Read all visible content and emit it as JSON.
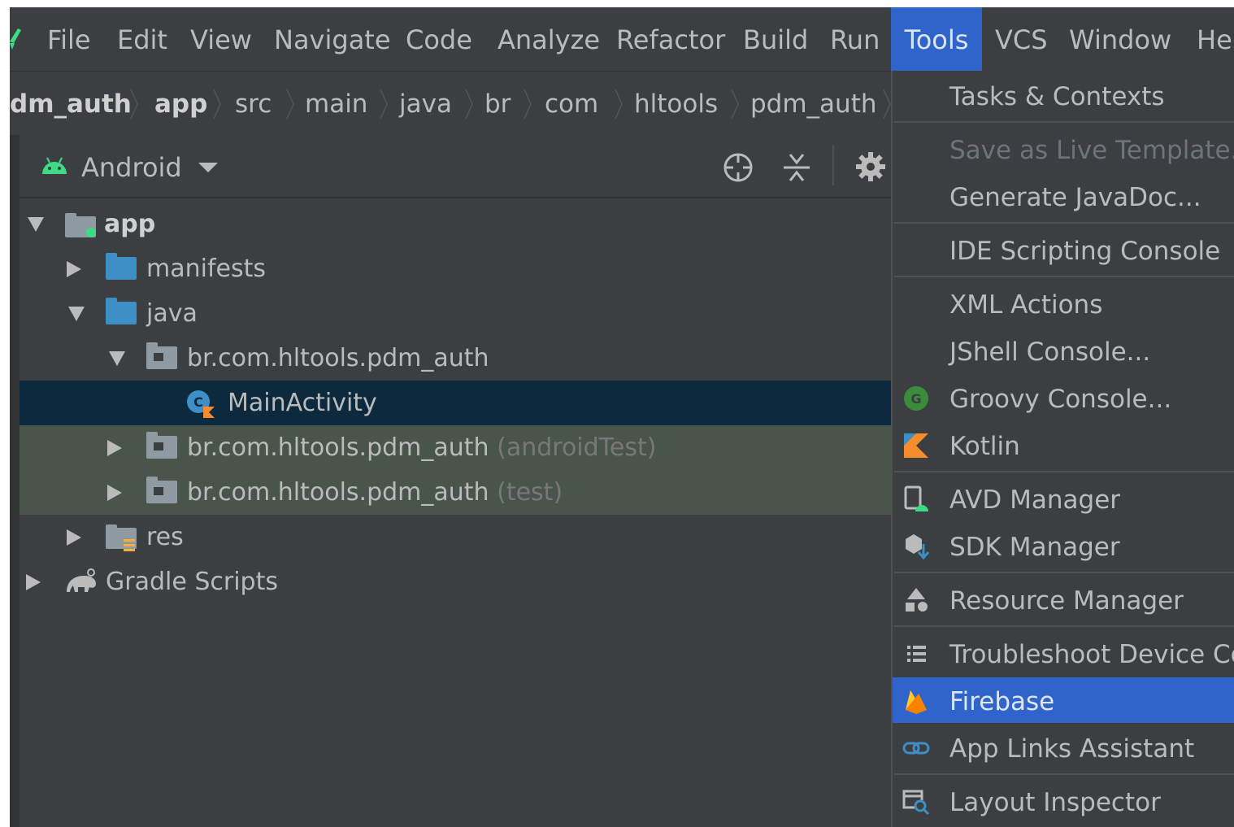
{
  "menubar": {
    "items": [
      {
        "label": "File"
      },
      {
        "label": "Edit"
      },
      {
        "label": "View"
      },
      {
        "label": "Navigate"
      },
      {
        "label": "Code"
      },
      {
        "label": "Analyze"
      },
      {
        "label": "Refactor"
      },
      {
        "label": "Build"
      },
      {
        "label": "Run"
      },
      {
        "label": "Tools"
      },
      {
        "label": "VCS"
      },
      {
        "label": "Window"
      },
      {
        "label": "He"
      }
    ],
    "active": "Tools"
  },
  "breadcrumb": [
    "dm_auth",
    "app",
    "src",
    "main",
    "java",
    "br",
    "com",
    "hltools",
    "pdm_auth"
  ],
  "project_panel": {
    "view_selector": "Android",
    "tree": [
      {
        "label": "app",
        "expanded": true
      },
      {
        "label": "manifests",
        "expanded": false
      },
      {
        "label": "java",
        "expanded": true
      },
      {
        "label": "br.com.hltools.pdm_auth",
        "expanded": true
      },
      {
        "label": "MainActivity",
        "selected": true
      },
      {
        "label": "br.com.hltools.pdm_auth",
        "suffix": "(androidTest)",
        "expanded": false
      },
      {
        "label": "br.com.hltools.pdm_auth",
        "suffix": "(test)",
        "expanded": false
      },
      {
        "label": "res",
        "expanded": false
      },
      {
        "label": "Gradle Scripts",
        "expanded": false
      }
    ]
  },
  "tools_menu": {
    "items": [
      {
        "label": "Tasks & Contexts"
      },
      {
        "label": "Save as Live Template...",
        "disabled": true
      },
      {
        "label": "Generate JavaDoc..."
      },
      {
        "label": "IDE Scripting Console"
      },
      {
        "label": "XML Actions"
      },
      {
        "label": "JShell Console..."
      },
      {
        "label": "Groovy Console...",
        "icon": "groovy-icon"
      },
      {
        "label": "Kotlin",
        "icon": "kotlin-icon"
      },
      {
        "label": "AVD Manager",
        "icon": "avd-manager-icon"
      },
      {
        "label": "SDK Manager",
        "icon": "sdk-manager-icon"
      },
      {
        "label": "Resource Manager",
        "icon": "resource-manager-icon"
      },
      {
        "label": "Troubleshoot Device Cor",
        "icon": "list-icon"
      },
      {
        "label": "Firebase",
        "icon": "firebase-icon",
        "highlighted": true
      },
      {
        "label": "App Links Assistant",
        "icon": "link-icon"
      },
      {
        "label": "Layout Inspector",
        "icon": "layout-inspector-icon"
      }
    ]
  },
  "colors": {
    "background": "#3c3f41",
    "menu_highlight": "#2f65ca",
    "selection": "#0d293e",
    "test_background": "#49544a",
    "android_green": "#3ddc84"
  }
}
